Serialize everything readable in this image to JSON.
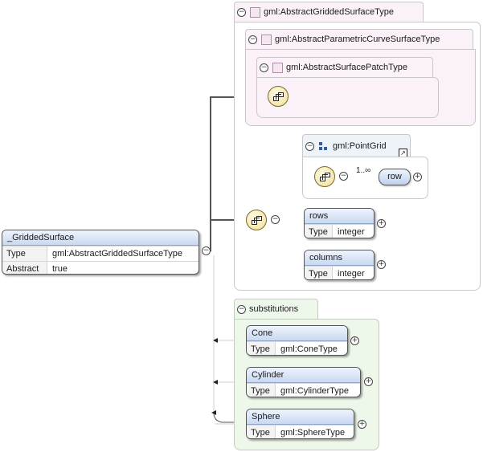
{
  "root": {
    "name": "_GriddedSurface",
    "rows": [
      {
        "key": "Type",
        "value": "gml:AbstractGriddedSurfaceType"
      },
      {
        "key": "Abstract",
        "value": "true"
      }
    ]
  },
  "types": {
    "outer": "gml:AbstractGriddedSurfaceType",
    "middle": "gml:AbstractParametricCurveSurfaceType",
    "inner": "gml:AbstractSurfacePatchType",
    "pointgrid": "gml:PointGrid"
  },
  "row_element": {
    "name": "row",
    "cardinality": "1..∞"
  },
  "child_elements": [
    {
      "name": "rows",
      "key": "Type",
      "value": "integer"
    },
    {
      "name": "columns",
      "key": "Type",
      "value": "integer"
    }
  ],
  "substitutions": {
    "label": "substitutions",
    "items": [
      {
        "name": "Cone",
        "key": "Type",
        "value": "gml:ConeType"
      },
      {
        "name": "Cylinder",
        "key": "Type",
        "value": "gml:CylinderType"
      },
      {
        "name": "Sphere",
        "key": "Type",
        "value": "gml:SphereType"
      }
    ]
  },
  "icons": {
    "collapse": "collapse-toggle-icon",
    "expand": "expand-plus-icon",
    "sequence": "sequence-compositor-icon",
    "complex-type": "complex-type-icon",
    "element-ref": "element-reference-icon"
  },
  "colors": {
    "type_bg": "#faf2f8",
    "element_header": "#c9d9f1",
    "substitution_bg": "#eef8ea"
  }
}
